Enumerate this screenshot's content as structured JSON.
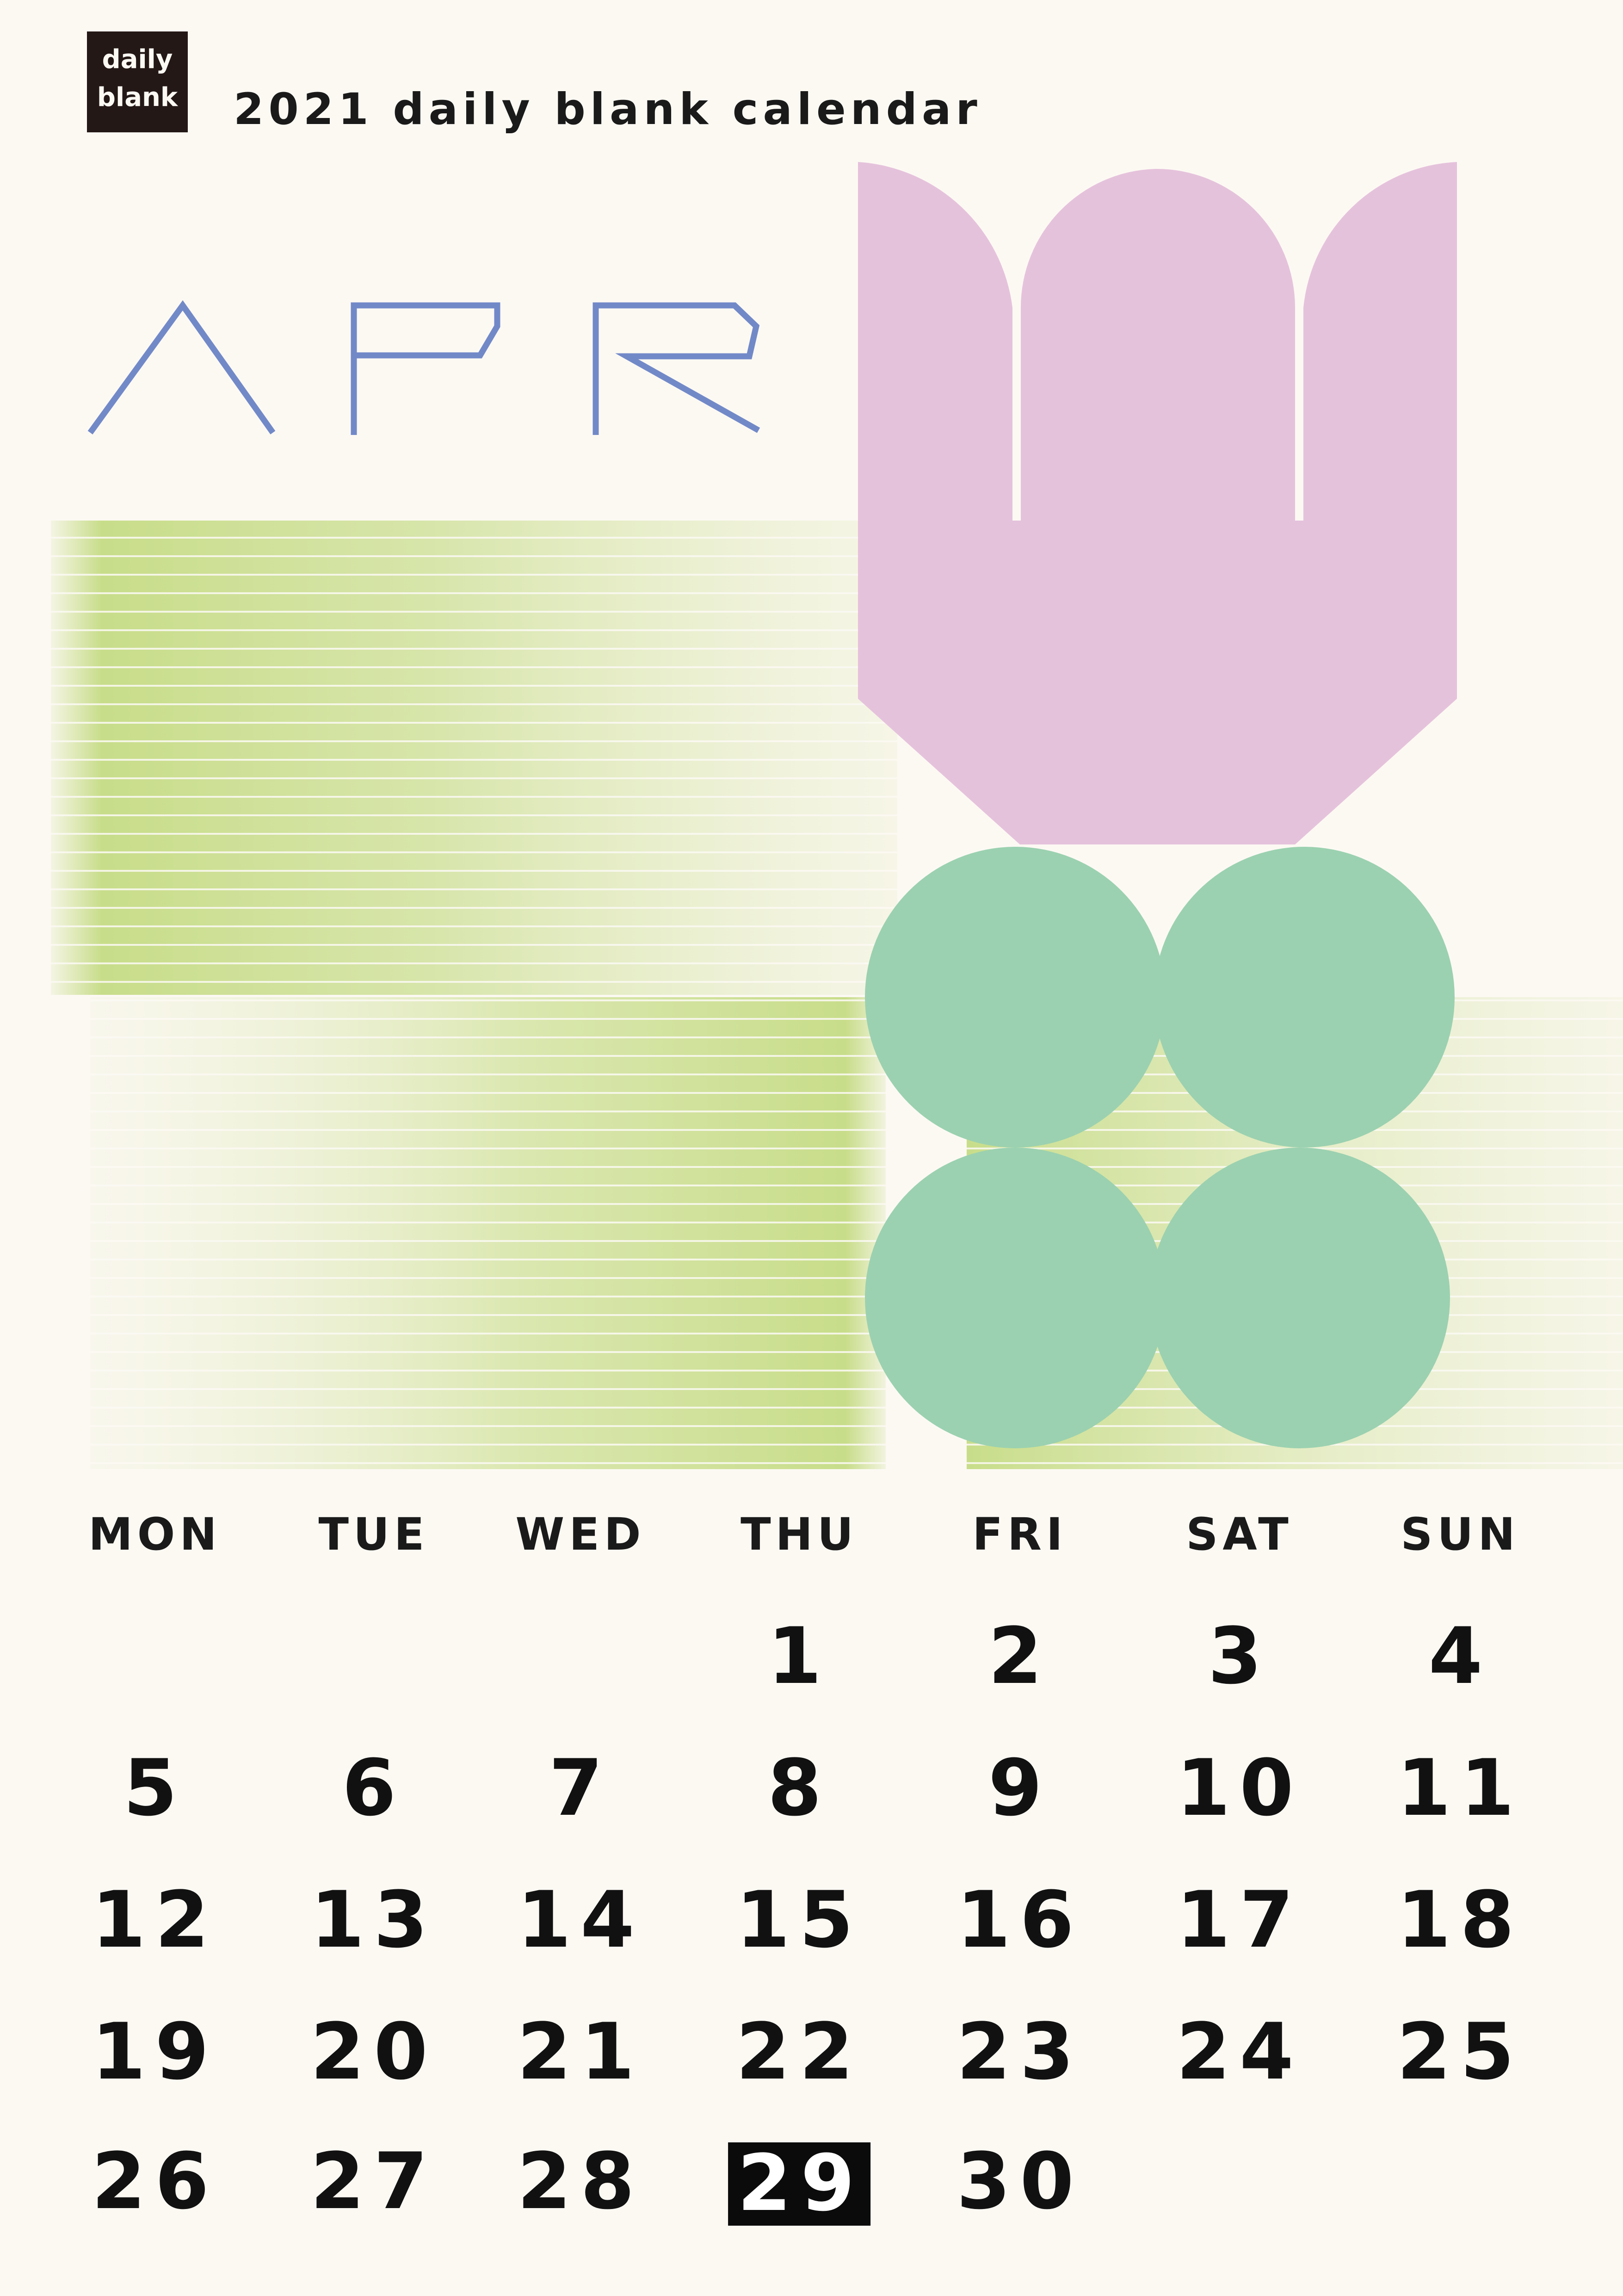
{
  "brand": {
    "logo_line1": "daily",
    "logo_line2": "blank"
  },
  "header": {
    "title": "2021 daily blank calendar"
  },
  "month": {
    "label": "APR"
  },
  "colors": {
    "background": "#fcf9f3",
    "tulip_pink": "#e5c2dc",
    "leaf_green": "#9bd1b0",
    "stripe_green": "#c8dd8a",
    "month_blue": "#7289c8",
    "highlight": "#0b0b0b"
  },
  "weekdays": [
    "MON",
    "TUE",
    "WED",
    "THU",
    "FRI",
    "SAT",
    "SUN"
  ],
  "weeks": [
    [
      "",
      "",
      "",
      "1",
      "2",
      "3",
      "4"
    ],
    [
      "5",
      "6",
      "7",
      "8",
      "9",
      "10",
      "11"
    ],
    [
      "12",
      "13",
      "14",
      "15",
      "16",
      "17",
      "18"
    ],
    [
      "19",
      "20",
      "21",
      "22",
      "23",
      "24",
      "25"
    ],
    [
      "26",
      "27",
      "28",
      "29",
      "30",
      "",
      ""
    ]
  ],
  "highlighted_day": "29"
}
